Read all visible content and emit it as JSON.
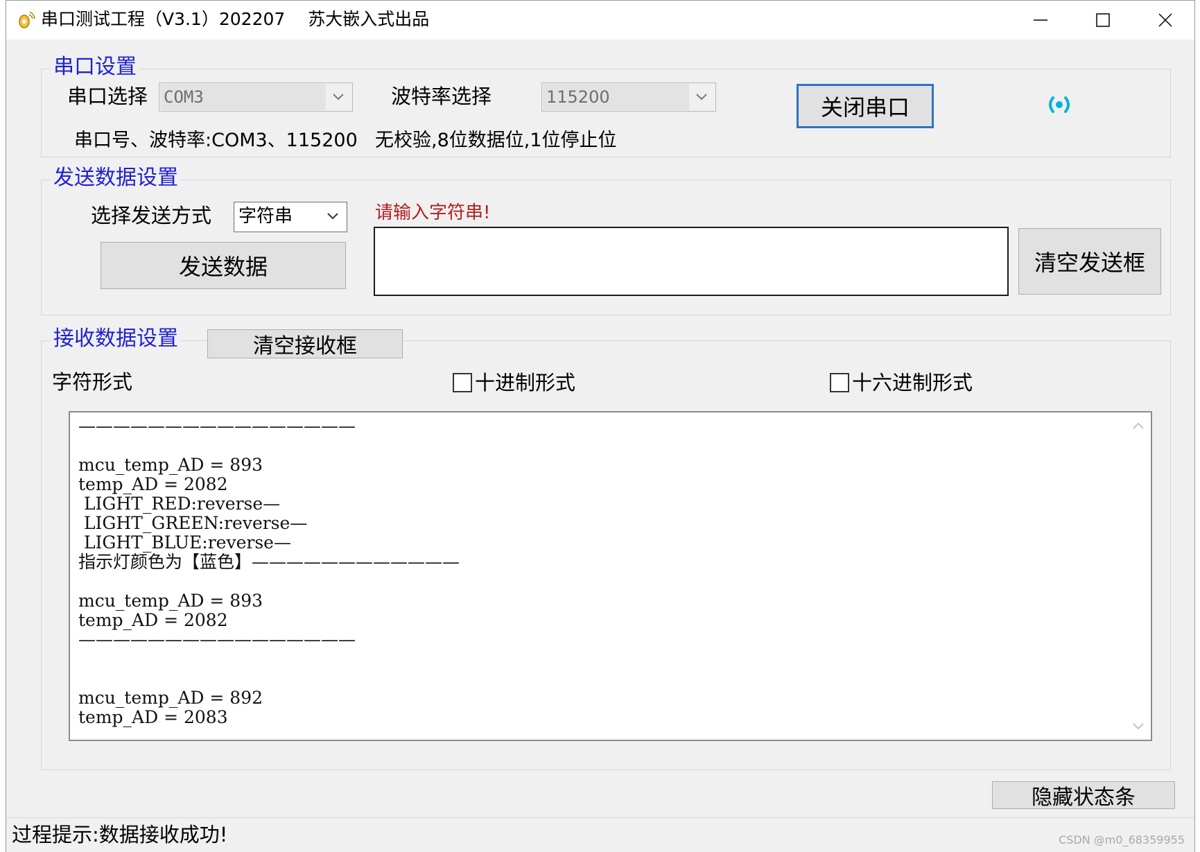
{
  "window": {
    "title": "串口测试工程（V3.1）202207　 苏大嵌入式出品",
    "buttons": {
      "minimize": "─",
      "maximize": "☐",
      "close": "✕"
    }
  },
  "serial_settings": {
    "legend": "串口设置",
    "port_label": "串口选择",
    "port_value": "COM3",
    "baud_label": "波特率选择",
    "baud_value": "115200",
    "close_button": "关闭串口",
    "info_port": "串口号、波特率:COM3、115200",
    "info_format": "无校验,8位数据位,1位停止位",
    "status_icon": "broadcast-icon",
    "status_color": "#00b4d8"
  },
  "send_settings": {
    "legend": "发送数据设置",
    "mode_label": "选择发送方式",
    "mode_value": "字符串",
    "send_button": "发送数据",
    "prompt": "请输入字符串!",
    "prompt_color": "#b02020",
    "input_value": "",
    "clear_button": "清空发送框"
  },
  "receive_settings": {
    "legend": "接收数据设置",
    "clear_button": "清空接收框",
    "char_label": "字符形式",
    "decimal_label": "十进制形式",
    "decimal_checked": false,
    "hex_label": "十六进制形式",
    "hex_checked": false,
    "log": "————————————————\n\nmcu_temp_AD = 893\ntemp_AD = 2082\n LIGHT_RED:reverse—\n LIGHT_GREEN:reverse—\n LIGHT_BLUE:reverse—\n指示灯颜色为【蓝色】————————————\n\nmcu_temp_AD = 893\ntemp_AD = 2082\n————————————————\n\n\nmcu_temp_AD = 892\ntemp_AD = 2083"
  },
  "footer": {
    "hide_status_button": "隐藏状态条",
    "status_text": "过程提示:数据接收成功!",
    "watermark": "CSDN @m0_68359955"
  },
  "legend_color": "#1f1fd6"
}
